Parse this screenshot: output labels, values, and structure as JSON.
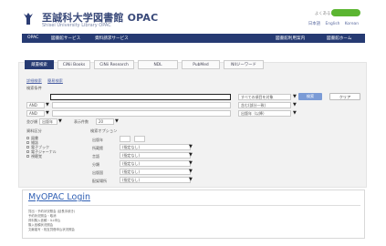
{
  "header": {
    "title": "至誠科大学図書館 OPAC",
    "subtitle": "Shisei University Library OPAC",
    "util_links": "よくあるご質問 | ヘルプ",
    "login_button": "",
    "lang_options": [
      "日本語",
      "English",
      "Korean"
    ]
  },
  "nav": {
    "left": [
      "OPAC",
      "図書館サービス",
      "資料請求サービス"
    ],
    "right": [
      "図書館利用案内",
      "図書館ホーム"
    ]
  },
  "tabs": [
    "蔵書検索",
    "CiNii Books",
    "CiNii Research",
    "NDL",
    "PubMed",
    "NIIジーワード"
  ],
  "breadcrumbs": [
    "詳細検索",
    "簡易検索"
  ],
  "search": {
    "section_label": "検索条件",
    "main_value": "",
    "target_select": "すべての項目を対象",
    "op_select1": "AND",
    "op_select2": "AND",
    "scope_select1": "含む(部分一致)",
    "scope_select2": "出版年（以降）",
    "search_button": "検索",
    "clear_button": "クリア",
    "display_count_label": "表示件数",
    "display_count_value": "20",
    "sort_label": "並び順",
    "sort_value": "出版年"
  },
  "filters": {
    "left_header": "資料区分",
    "left_options": [
      "図書",
      "雑誌",
      "電子ブック",
      "電子ジャーナル",
      "視聴覚"
    ],
    "right_header": "検索オプション",
    "right_rows": [
      {
        "label": "出版年",
        "value": ""
      },
      {
        "label": "所蔵館",
        "value": "(指定なし)"
      },
      {
        "label": "言語",
        "value": "(指定なし)"
      },
      {
        "label": "分類",
        "value": "(指定なし)"
      },
      {
        "label": "出版国",
        "value": "(指定なし)"
      },
      {
        "label": "配架場所",
        "value": "(指定なし)"
      }
    ]
  },
  "myopac": {
    "title": "MyOPAC Login",
    "items": [
      "貸出・予約状況照会 (延長手続き)",
      "予約状況照会・取消",
      "資料購入依頼・ILL申込",
      "購入依頼状況照会",
      "文献複写・相互貸借申込状況照会"
    ]
  }
}
